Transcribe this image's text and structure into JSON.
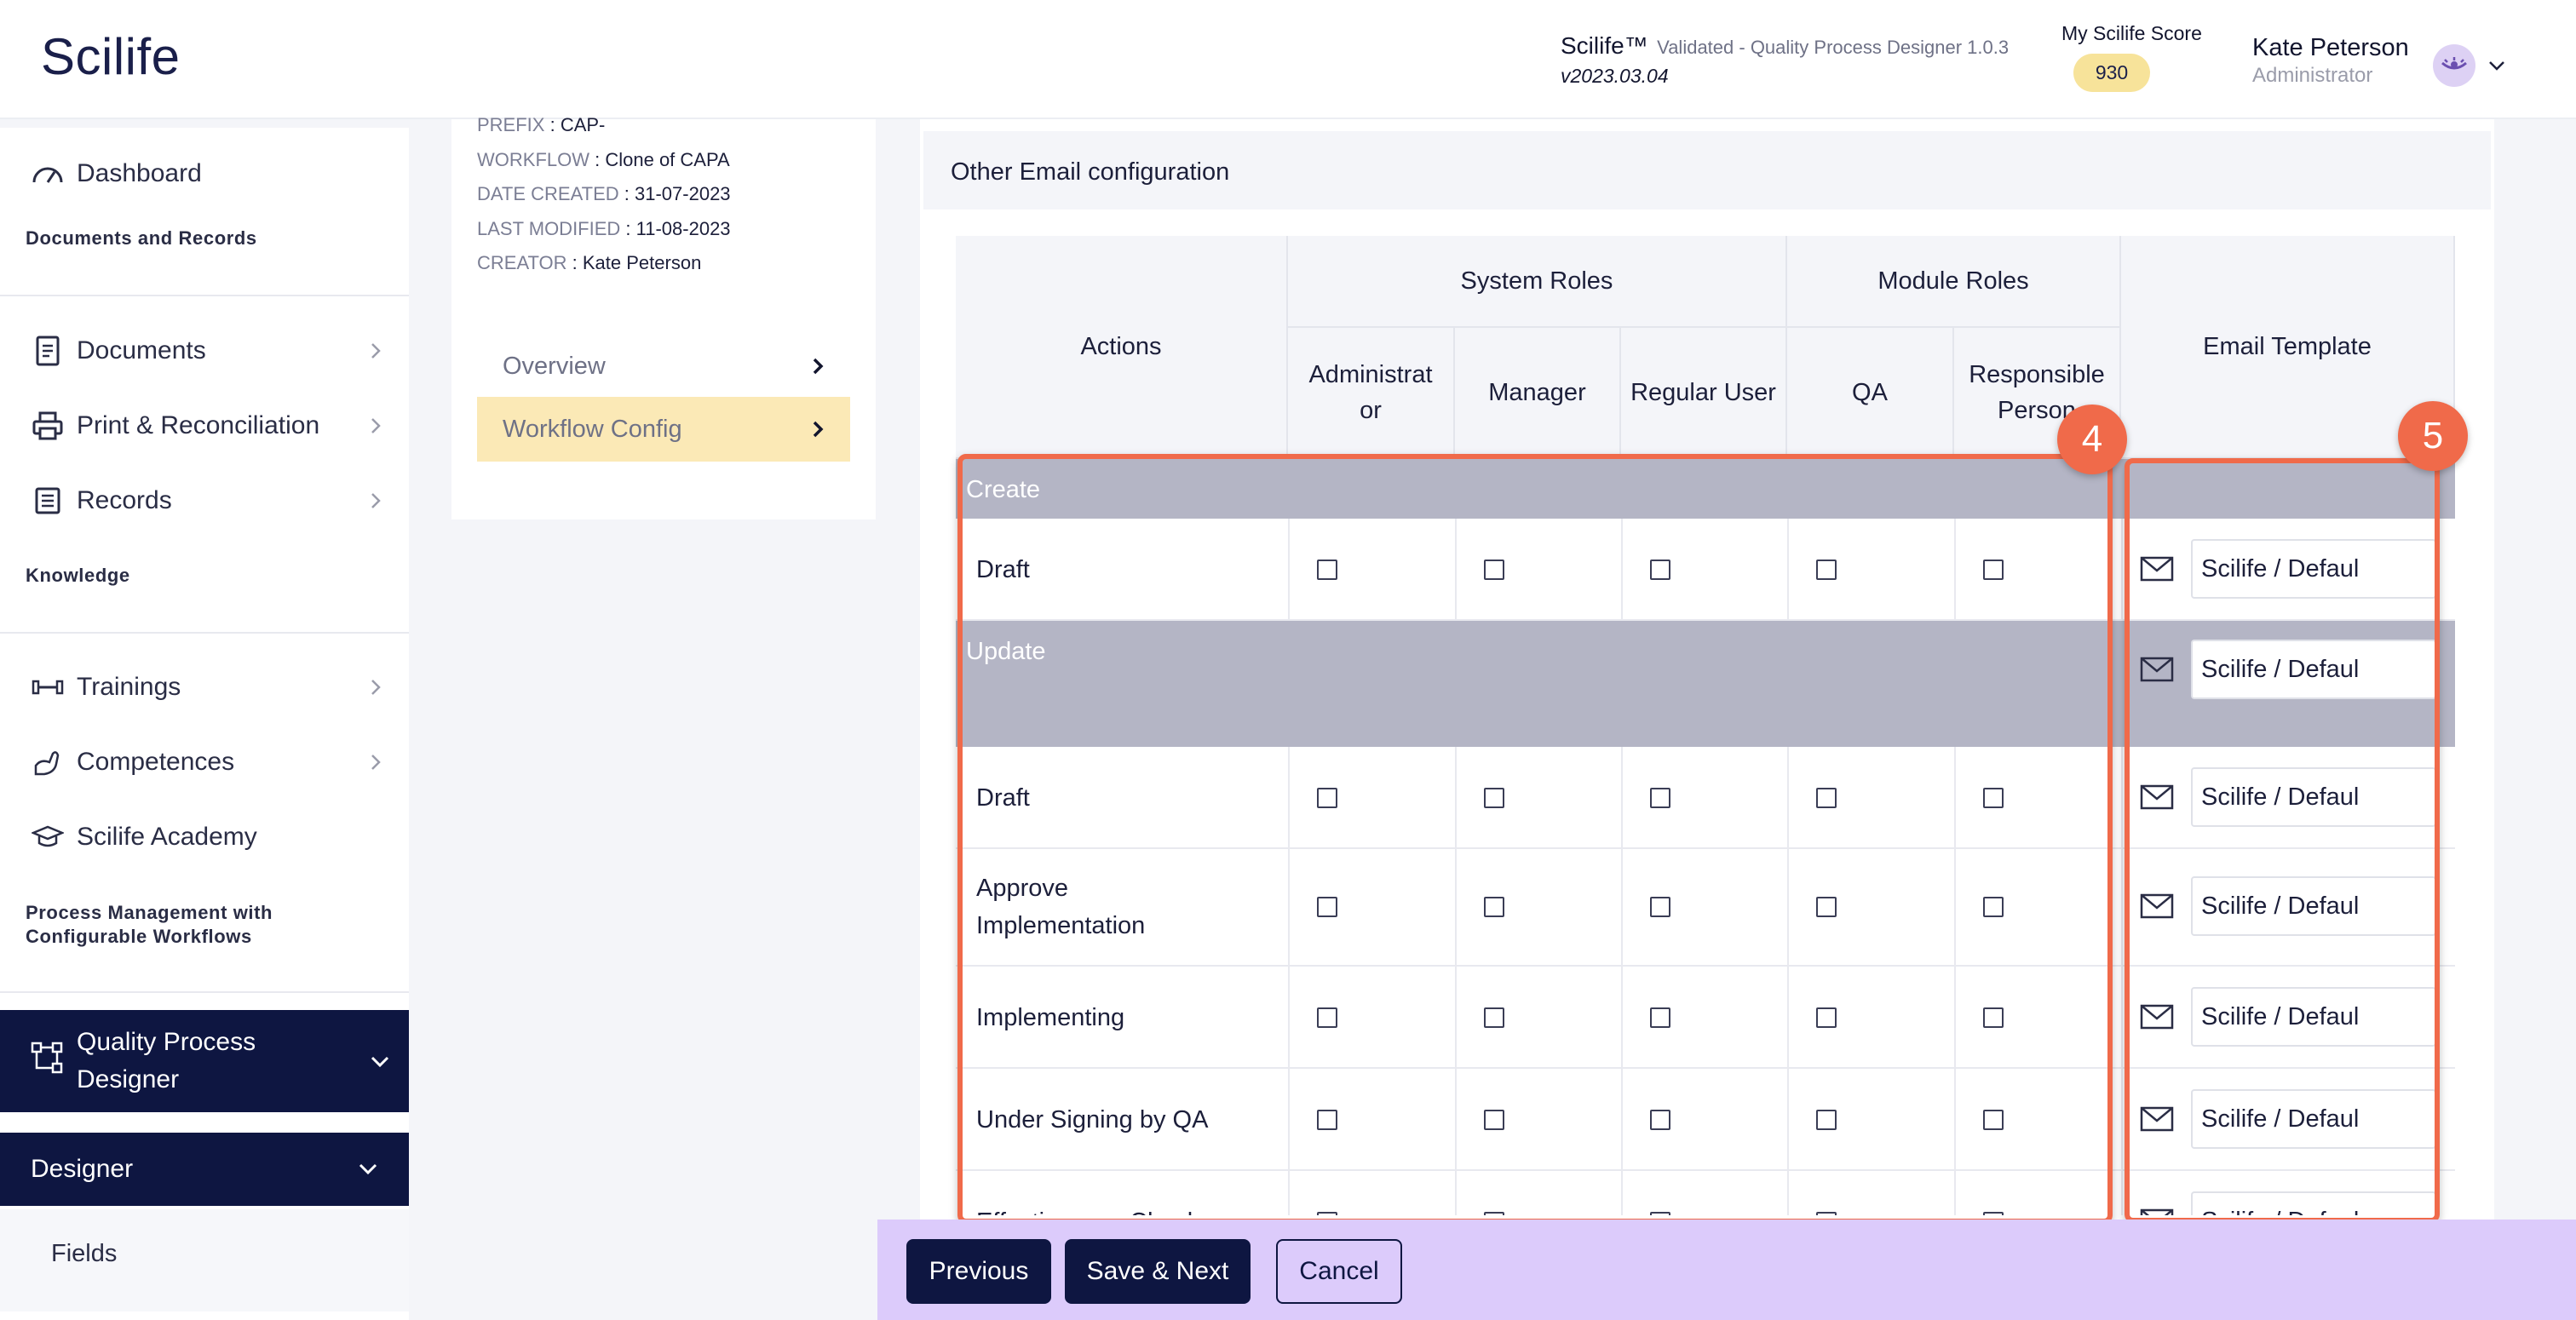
{
  "header": {
    "logo": "Scilife",
    "app_name": "Scilife™",
    "app_sub": "Validated - Quality Process Designer 1.0.3",
    "app_version": "v2023.03.04",
    "score_label": "My Scilife Score",
    "score_value": "930",
    "user_name": "Kate Peterson",
    "user_role": "Administrator"
  },
  "sidebar": {
    "dashboard": "Dashboard",
    "section_docs": "Documents and Records",
    "documents": "Documents",
    "print": "Print & Reconciliation",
    "records": "Records",
    "section_knowledge": "Knowledge",
    "trainings": "Trainings",
    "competences": "Competences",
    "academy": "Scilife Academy",
    "section_process": "Process Management with Configurable Workflows",
    "qpd": "Quality Process Designer",
    "designer": "Designer",
    "fields": "Fields"
  },
  "meta": {
    "prefix_key": "PREFIX",
    "prefix_val": "CAP-",
    "workflow_key": "WORKFLOW",
    "workflow_val": "Clone of CAPA",
    "created_key": "DATE CREATED",
    "created_val": "31-07-2023",
    "modified_key": "LAST MODIFIED",
    "modified_val": "11-08-2023",
    "creator_key": "CREATOR",
    "creator_val": "Kate Peterson",
    "sep": " : ",
    "nav_overview": "Overview",
    "nav_workflow_config": "Workflow Config"
  },
  "config": {
    "title": "Other Email configuration",
    "headers": {
      "actions": "Actions",
      "system_roles": "System Roles",
      "module_roles": "Module Roles",
      "email_template": "Email Template",
      "administrator": "Administrat or",
      "manager": "Manager",
      "regular_user": "Regular User",
      "qa": "QA",
      "responsible_person": "Responsible Person"
    },
    "groups": {
      "create": "Create",
      "update": "Update"
    },
    "rows": [
      {
        "action": "Draft",
        "template": "Scilife / Defaul"
      },
      {
        "action": "Draft",
        "template": "Scilife / Defaul"
      },
      {
        "action": "Approve Implementation",
        "template": "Scilife / Defaul"
      },
      {
        "action": "Implementing",
        "template": "Scilife / Defaul"
      },
      {
        "action": "Under Signing by QA",
        "template": "Scilife / Defaul"
      },
      {
        "action": "Effectiveness Check",
        "template": "Scilife / Defaul"
      }
    ],
    "update_template": "Scilife / Defaul"
  },
  "annotations": {
    "badge_4": "4",
    "badge_5": "5",
    "highlight_color": "#f06a4a"
  },
  "footer": {
    "previous": "Previous",
    "save_next": "Save & Next",
    "cancel": "Cancel"
  }
}
